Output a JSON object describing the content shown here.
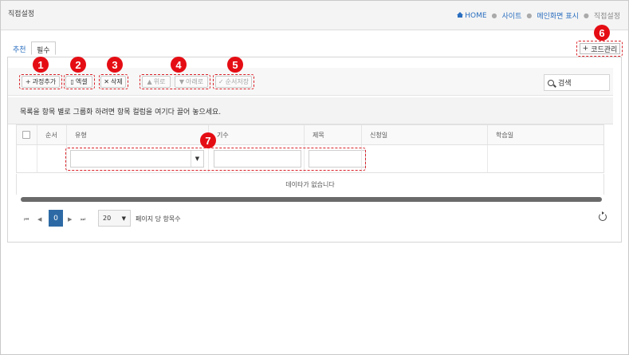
{
  "header": {
    "title": "직접설정",
    "breadcrumb": [
      {
        "label": "HOME"
      },
      {
        "label": "사이트"
      },
      {
        "label": "메인화면 표시"
      },
      {
        "label": "직접설정"
      }
    ]
  },
  "tabs": [
    {
      "label": "추천",
      "active": false
    },
    {
      "label": "필수",
      "active": true
    }
  ],
  "code_button": {
    "icon": "plus-icon",
    "label": "코드관리"
  },
  "toolbar": {
    "add_label": "과정추가",
    "excel_label": "엑셀",
    "delete_label": "삭제",
    "up_label": "위로",
    "down_label": "아래로",
    "save_order_label": "순서저장",
    "search_placeholder": "검색"
  },
  "group_hint": "목록을 항목 별로 그룹화 하려면 항목 컬럼을 여기다 끌어 놓으세요.",
  "grid": {
    "columns": [
      "순서",
      "유형",
      "기수",
      "제목",
      "신청일",
      "학습일"
    ],
    "empty_message": "데이타가 없습니다"
  },
  "pager": {
    "current_page": "0",
    "page_size": "20",
    "page_size_label": "페이지 당 항목수"
  },
  "annotations": [
    "1",
    "2",
    "3",
    "4",
    "5",
    "6",
    "7"
  ],
  "colors": {
    "accent": "#2a6ebf",
    "annotation": "#e50d14",
    "pager_active": "#2d6aa5"
  }
}
